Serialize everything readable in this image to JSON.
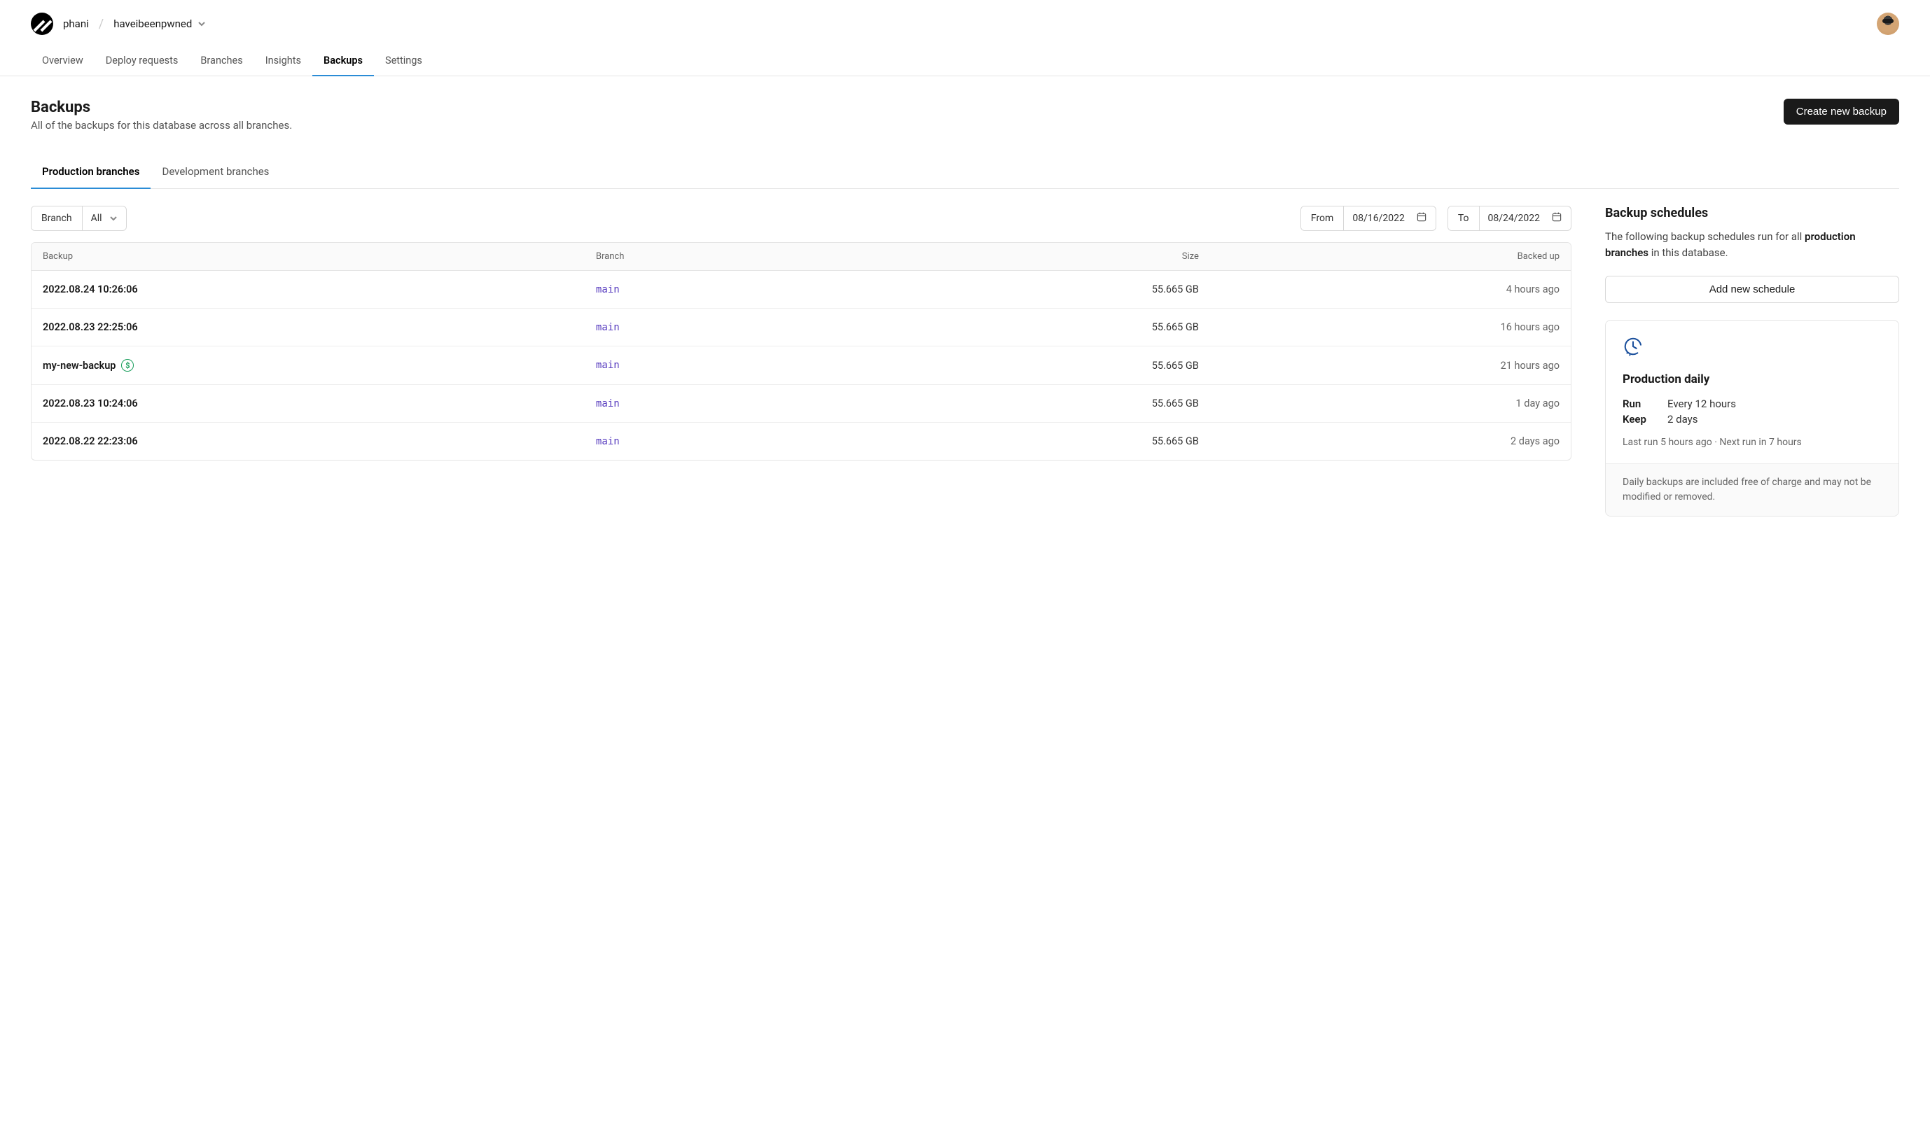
{
  "breadcrumb": {
    "org": "phani",
    "project": "haveibeenpwned"
  },
  "nav_tabs": [
    "Overview",
    "Deploy requests",
    "Branches",
    "Insights",
    "Backups",
    "Settings"
  ],
  "nav_active": "Backups",
  "page": {
    "title": "Backups",
    "subtitle": "All of the backups for this database across all branches.",
    "create_button": "Create new backup"
  },
  "sub_tabs": [
    "Production branches",
    "Development branches"
  ],
  "sub_tab_active": "Production branches",
  "filters": {
    "branch_label": "Branch",
    "branch_value": "All",
    "from_label": "From",
    "from_value": "08/16/2022",
    "to_label": "To",
    "to_value": "08/24/2022"
  },
  "table": {
    "headers": [
      "Backup",
      "Branch",
      "Size",
      "Backed up"
    ],
    "rows": [
      {
        "name": "2022.08.24 10:26:06",
        "paid": false,
        "branch": "main",
        "size": "55.665 GB",
        "age": "4 hours ago"
      },
      {
        "name": "2022.08.23 22:25:06",
        "paid": false,
        "branch": "main",
        "size": "55.665 GB",
        "age": "16 hours ago"
      },
      {
        "name": "my-new-backup",
        "paid": true,
        "branch": "main",
        "size": "55.665 GB",
        "age": "21 hours ago"
      },
      {
        "name": "2022.08.23 10:24:06",
        "paid": false,
        "branch": "main",
        "size": "55.665 GB",
        "age": "1 day ago"
      },
      {
        "name": "2022.08.22 22:23:06",
        "paid": false,
        "branch": "main",
        "size": "55.665 GB",
        "age": "2 days ago"
      }
    ]
  },
  "schedules": {
    "heading": "Backup schedules",
    "desc_pre": "The following backup schedules run for all ",
    "desc_bold": "production branches",
    "desc_post": " in this database.",
    "add_button": "Add new schedule",
    "card": {
      "title": "Production daily",
      "run_label": "Run",
      "run_value": "Every 12 hours",
      "keep_label": "Keep",
      "keep_value": "2 days",
      "meta": "Last run 5 hours ago  ·  Next run in 7 hours",
      "footer": "Daily backups are included free of charge and may not be modified or removed."
    }
  }
}
